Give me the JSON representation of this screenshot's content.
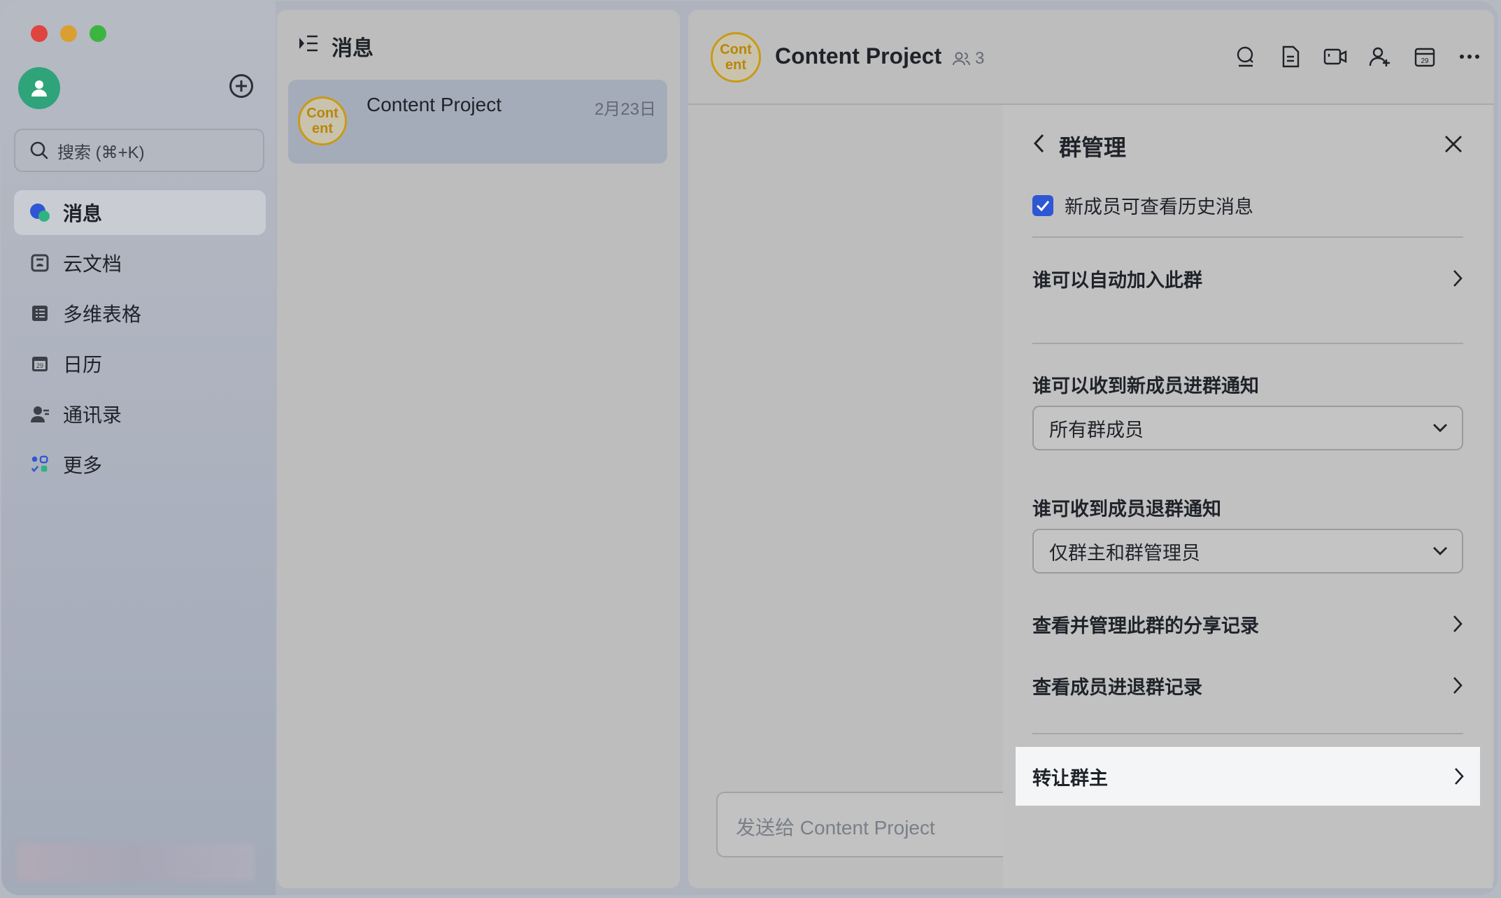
{
  "sidebar": {
    "search_placeholder": "搜索 (⌘+K)",
    "items": [
      {
        "label": "消息",
        "icon": "chat-bubble-icon"
      },
      {
        "label": "云文档",
        "icon": "cloud-doc-icon"
      },
      {
        "label": "多维表格",
        "icon": "table-icon"
      },
      {
        "label": "日历",
        "icon": "calendar-icon"
      },
      {
        "label": "通讯录",
        "icon": "contacts-icon"
      },
      {
        "label": "更多",
        "icon": "apps-icon"
      }
    ]
  },
  "message_list": {
    "title": "消息",
    "chats": [
      {
        "name": "Content Project",
        "date": "2月23日",
        "avatar_text": "Cont ent"
      }
    ]
  },
  "chat": {
    "title": "Content Project",
    "member_count": "3",
    "avatar_text": "Cont ent",
    "composer_placeholder": "发送给 Content Project"
  },
  "drawer": {
    "title": "群管理",
    "history_checkbox_label": "新成员可查看历史消息",
    "history_checked": true,
    "auto_join_label": "谁可以自动加入此群",
    "join_notice_label": "谁可以收到新成员进群通知",
    "join_notice_value": "所有群成员",
    "leave_notice_label": "谁可收到成员退群通知",
    "leave_notice_value": "仅群主和群管理员",
    "share_records_label": "查看并管理此群的分享记录",
    "member_records_label": "查看成员进退群记录",
    "transfer_owner_label": "转让群主"
  },
  "colors": {
    "accent": "#2f56d3",
    "avatar_green": "#2fa37a",
    "group_avatar_gold": "#c89a17"
  }
}
